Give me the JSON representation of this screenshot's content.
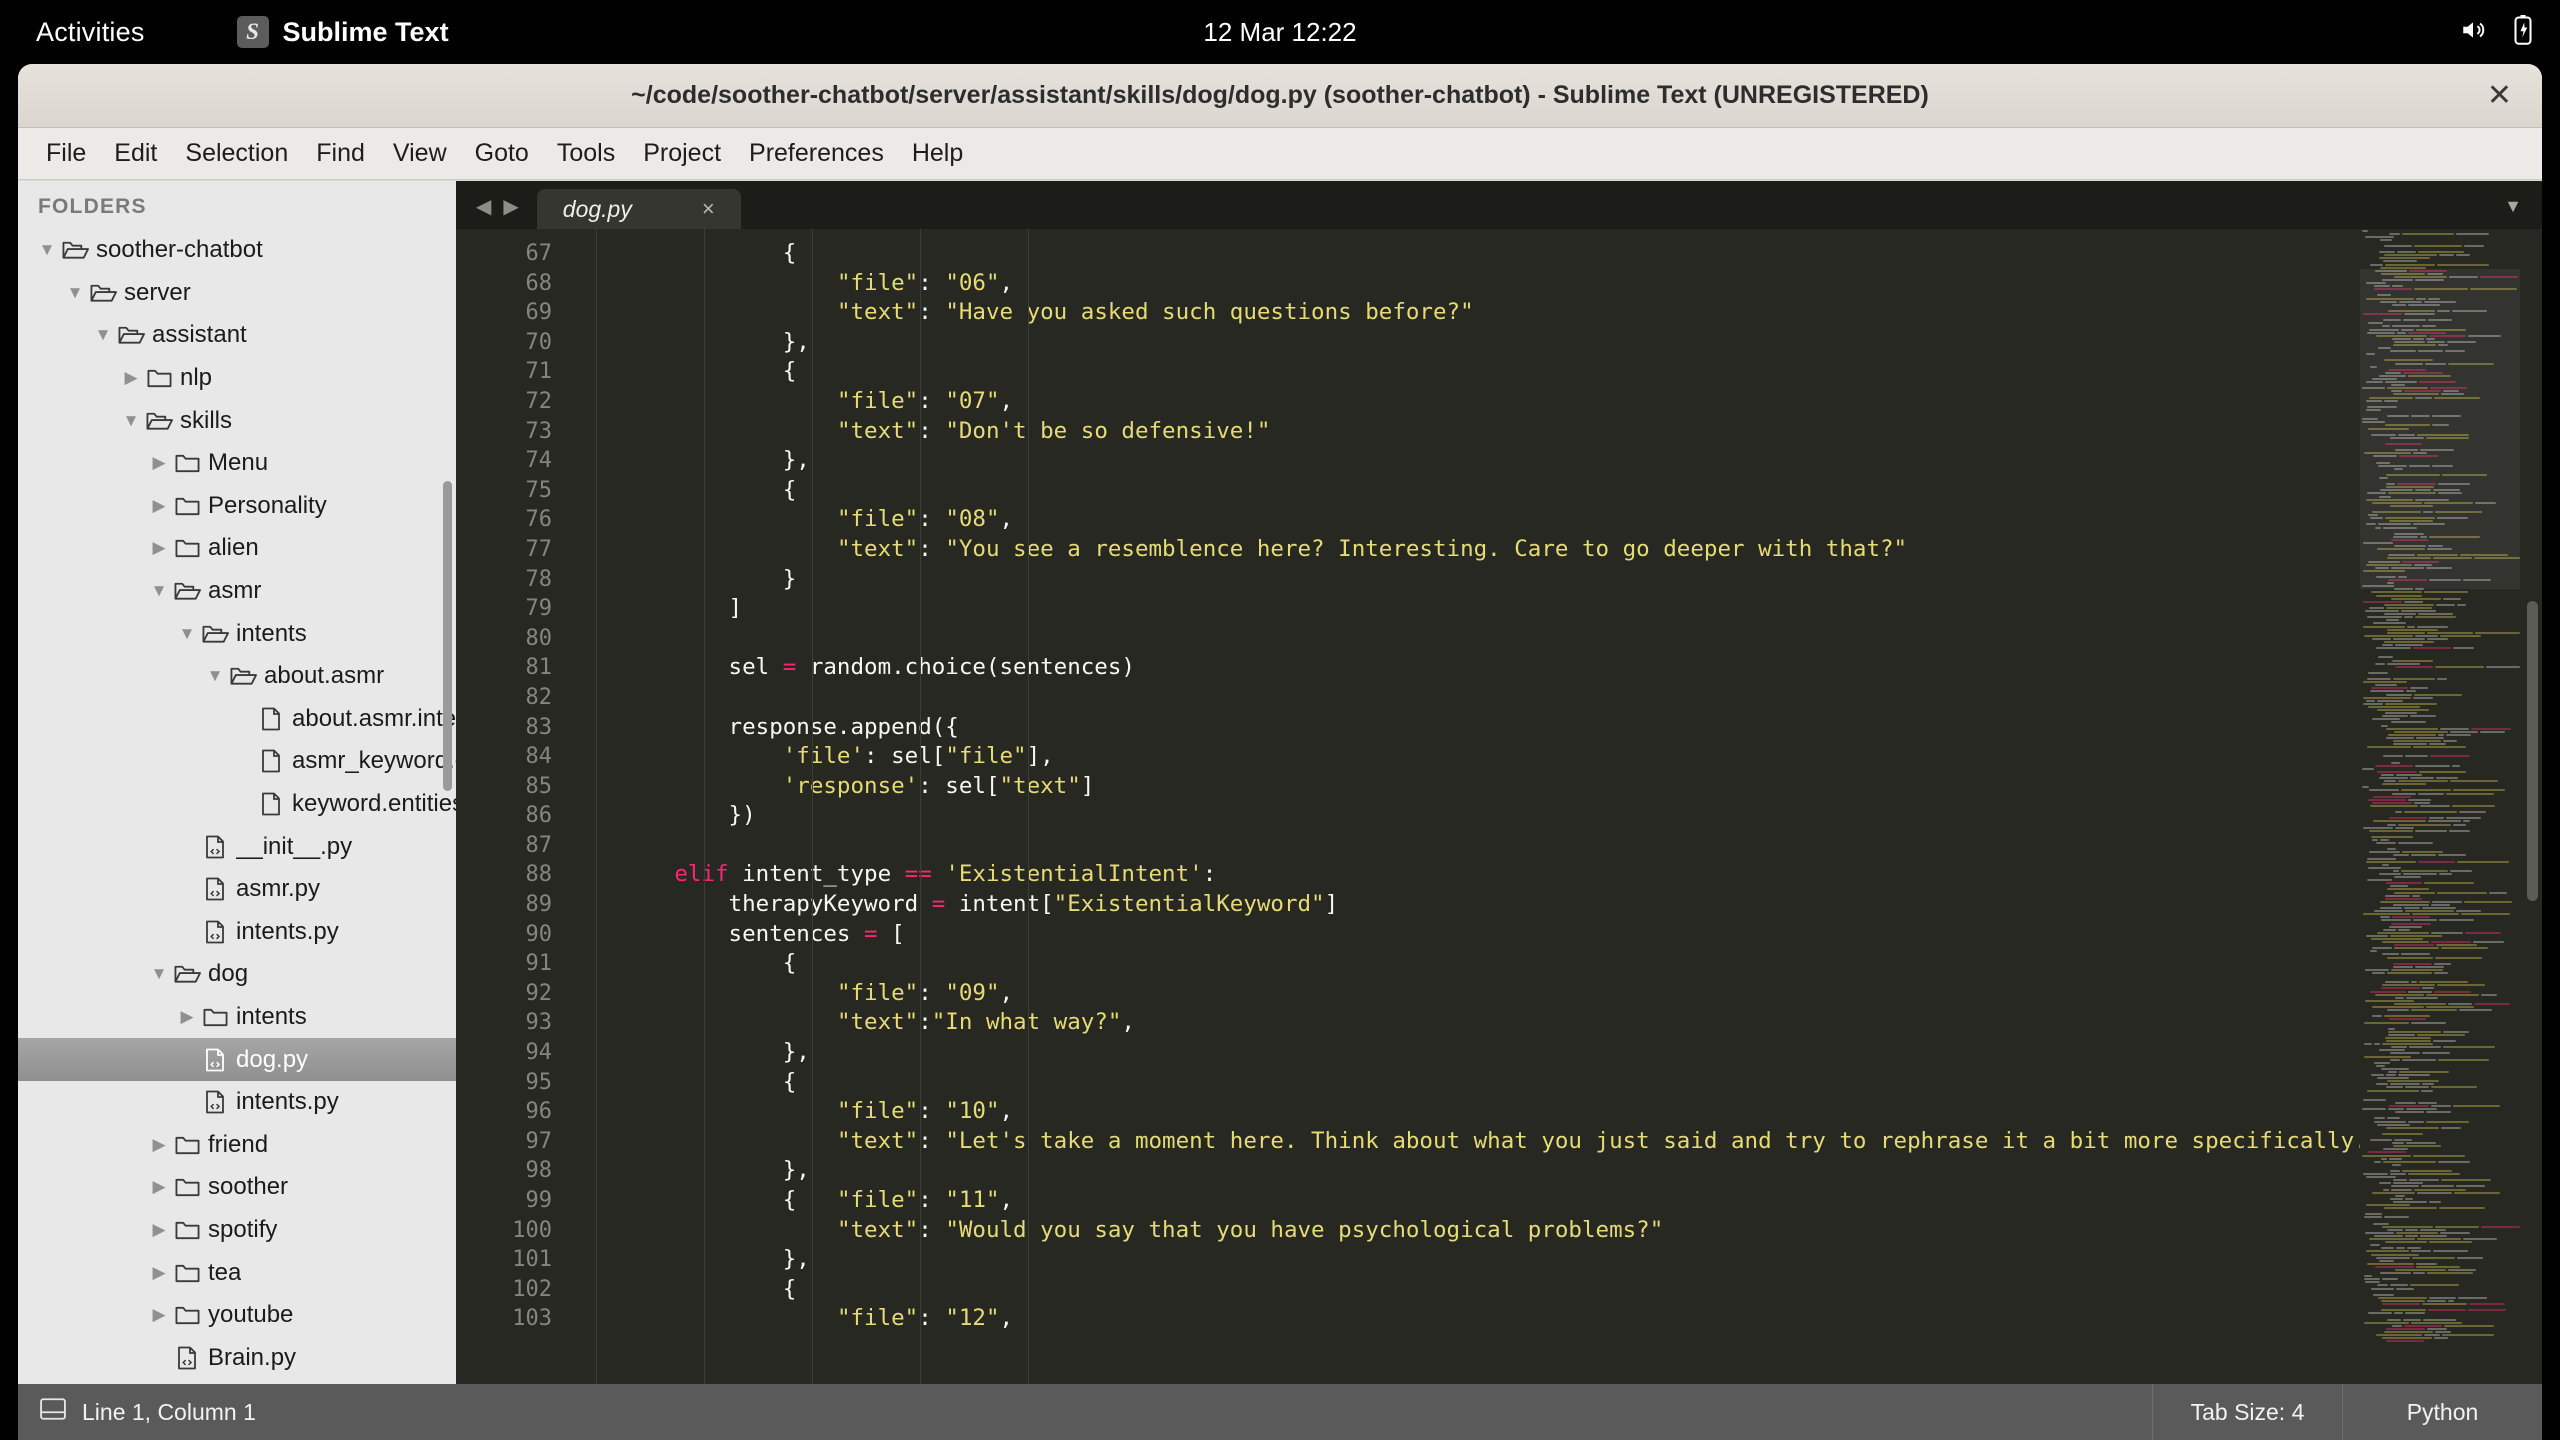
{
  "gnome": {
    "activities": "Activities",
    "app_name": "Sublime Text",
    "app_logo_glyph": "S",
    "clock": "12 Mar  12:22",
    "tray": [
      "volume-icon",
      "battery-icon"
    ]
  },
  "window": {
    "title": "~/code/soother-chatbot/server/assistant/skills/dog/dog.py (soother-chatbot) - Sublime Text (UNREGISTERED)",
    "close_glyph": "✕"
  },
  "menubar": [
    "File",
    "Edit",
    "Selection",
    "Find",
    "View",
    "Goto",
    "Tools",
    "Project",
    "Preferences",
    "Help"
  ],
  "sidebar": {
    "header": "FOLDERS",
    "tree": [
      {
        "label": "soother-chatbot",
        "depth": 0,
        "type": "folder",
        "state": "open"
      },
      {
        "label": "server",
        "depth": 1,
        "type": "folder",
        "state": "open"
      },
      {
        "label": "assistant",
        "depth": 2,
        "type": "folder",
        "state": "open"
      },
      {
        "label": "nlp",
        "depth": 3,
        "type": "folder",
        "state": "closed"
      },
      {
        "label": "skills",
        "depth": 3,
        "type": "folder",
        "state": "open"
      },
      {
        "label": "Menu",
        "depth": 4,
        "type": "folder",
        "state": "closed"
      },
      {
        "label": "Personality",
        "depth": 4,
        "type": "folder",
        "state": "closed"
      },
      {
        "label": "alien",
        "depth": 4,
        "type": "folder",
        "state": "closed"
      },
      {
        "label": "asmr",
        "depth": 4,
        "type": "folder",
        "state": "open"
      },
      {
        "label": "intents",
        "depth": 5,
        "type": "folder",
        "state": "open"
      },
      {
        "label": "about.asmr",
        "depth": 6,
        "type": "folder",
        "state": "open"
      },
      {
        "label": "about.asmr.intent",
        "depth": 7,
        "type": "file",
        "state": "none"
      },
      {
        "label": "asmr_keyword.entity",
        "depth": 7,
        "type": "file",
        "state": "none"
      },
      {
        "label": "keyword.entities",
        "depth": 7,
        "type": "file",
        "state": "none"
      },
      {
        "label": "__init__.py",
        "depth": 5,
        "type": "pyfile",
        "state": "none"
      },
      {
        "label": "asmr.py",
        "depth": 5,
        "type": "pyfile",
        "state": "none"
      },
      {
        "label": "intents.py",
        "depth": 5,
        "type": "pyfile",
        "state": "none"
      },
      {
        "label": "dog",
        "depth": 4,
        "type": "folder",
        "state": "open"
      },
      {
        "label": "intents",
        "depth": 5,
        "type": "folder",
        "state": "closed"
      },
      {
        "label": "dog.py",
        "depth": 5,
        "type": "pyfile",
        "state": "none",
        "selected": true
      },
      {
        "label": "intents.py",
        "depth": 5,
        "type": "pyfile",
        "state": "none"
      },
      {
        "label": "friend",
        "depth": 4,
        "type": "folder",
        "state": "closed"
      },
      {
        "label": "soother",
        "depth": 4,
        "type": "folder",
        "state": "closed"
      },
      {
        "label": "spotify",
        "depth": 4,
        "type": "folder",
        "state": "closed"
      },
      {
        "label": "tea",
        "depth": 4,
        "type": "folder",
        "state": "closed"
      },
      {
        "label": "youtube",
        "depth": 4,
        "type": "folder",
        "state": "closed"
      },
      {
        "label": "Brain.py",
        "depth": 4,
        "type": "pyfile",
        "state": "none"
      }
    ]
  },
  "editor": {
    "tab_nav_prev": "◀",
    "tab_nav_next": "▶",
    "tab_name": "dog.py",
    "tab_close_glyph": "×",
    "tab_menu_glyph": "▼",
    "first_line_number": 67,
    "lines": [
      {
        "n": 67,
        "tokens": [
          {
            "t": "                {",
            "c": "pl"
          }
        ]
      },
      {
        "n": 68,
        "tokens": [
          {
            "t": "                    ",
            "c": "pl"
          },
          {
            "t": "\"file\"",
            "c": "str"
          },
          {
            "t": ": ",
            "c": "pl"
          },
          {
            "t": "\"06\"",
            "c": "str"
          },
          {
            "t": ",",
            "c": "pl"
          }
        ]
      },
      {
        "n": 69,
        "tokens": [
          {
            "t": "                    ",
            "c": "pl"
          },
          {
            "t": "\"text\"",
            "c": "str"
          },
          {
            "t": ": ",
            "c": "pl"
          },
          {
            "t": "\"Have you asked such questions before?\"",
            "c": "str"
          }
        ]
      },
      {
        "n": 70,
        "tokens": [
          {
            "t": "                },",
            "c": "pl"
          }
        ]
      },
      {
        "n": 71,
        "tokens": [
          {
            "t": "                {",
            "c": "pl"
          }
        ]
      },
      {
        "n": 72,
        "tokens": [
          {
            "t": "                    ",
            "c": "pl"
          },
          {
            "t": "\"file\"",
            "c": "str"
          },
          {
            "t": ": ",
            "c": "pl"
          },
          {
            "t": "\"07\"",
            "c": "str"
          },
          {
            "t": ",",
            "c": "pl"
          }
        ]
      },
      {
        "n": 73,
        "tokens": [
          {
            "t": "                    ",
            "c": "pl"
          },
          {
            "t": "\"text\"",
            "c": "str"
          },
          {
            "t": ": ",
            "c": "pl"
          },
          {
            "t": "\"Don't be so defensive!\"",
            "c": "str"
          }
        ]
      },
      {
        "n": 74,
        "tokens": [
          {
            "t": "                },",
            "c": "pl"
          }
        ]
      },
      {
        "n": 75,
        "tokens": [
          {
            "t": "                {",
            "c": "pl"
          }
        ]
      },
      {
        "n": 76,
        "tokens": [
          {
            "t": "                    ",
            "c": "pl"
          },
          {
            "t": "\"file\"",
            "c": "str"
          },
          {
            "t": ": ",
            "c": "pl"
          },
          {
            "t": "\"08\"",
            "c": "str"
          },
          {
            "t": ",",
            "c": "pl"
          }
        ]
      },
      {
        "n": 77,
        "tokens": [
          {
            "t": "                    ",
            "c": "pl"
          },
          {
            "t": "\"text\"",
            "c": "str"
          },
          {
            "t": ": ",
            "c": "pl"
          },
          {
            "t": "\"You see a resemblence here? Interesting. Care to go deeper with that?\"",
            "c": "str"
          }
        ]
      },
      {
        "n": 78,
        "tokens": [
          {
            "t": "                }",
            "c": "pl"
          }
        ]
      },
      {
        "n": 79,
        "tokens": [
          {
            "t": "            ]",
            "c": "pl"
          }
        ]
      },
      {
        "n": 80,
        "tokens": [
          {
            "t": "",
            "c": "pl"
          }
        ]
      },
      {
        "n": 81,
        "tokens": [
          {
            "t": "            sel ",
            "c": "pl"
          },
          {
            "t": "=",
            "c": "op"
          },
          {
            "t": " random.choice(sentences)",
            "c": "pl"
          }
        ]
      },
      {
        "n": 82,
        "tokens": [
          {
            "t": "",
            "c": "pl"
          }
        ]
      },
      {
        "n": 83,
        "tokens": [
          {
            "t": "            response.append({",
            "c": "pl"
          }
        ]
      },
      {
        "n": 84,
        "tokens": [
          {
            "t": "                ",
            "c": "pl"
          },
          {
            "t": "'file'",
            "c": "str"
          },
          {
            "t": ": sel[",
            "c": "pl"
          },
          {
            "t": "\"file\"",
            "c": "str"
          },
          {
            "t": "],",
            "c": "pl"
          }
        ]
      },
      {
        "n": 85,
        "tokens": [
          {
            "t": "                ",
            "c": "pl"
          },
          {
            "t": "'response'",
            "c": "str"
          },
          {
            "t": ": sel[",
            "c": "pl"
          },
          {
            "t": "\"text\"",
            "c": "str"
          },
          {
            "t": "]",
            "c": "pl"
          }
        ]
      },
      {
        "n": 86,
        "tokens": [
          {
            "t": "            })",
            "c": "pl"
          }
        ]
      },
      {
        "n": 87,
        "tokens": [
          {
            "t": "",
            "c": "pl"
          }
        ]
      },
      {
        "n": 88,
        "tokens": [
          {
            "t": "        ",
            "c": "pl"
          },
          {
            "t": "elif",
            "c": "kw"
          },
          {
            "t": " intent_type ",
            "c": "pl"
          },
          {
            "t": "==",
            "c": "op"
          },
          {
            "t": " ",
            "c": "pl"
          },
          {
            "t": "'ExistentialIntent'",
            "c": "str"
          },
          {
            "t": ":",
            "c": "pl"
          }
        ]
      },
      {
        "n": 89,
        "tokens": [
          {
            "t": "            therapyKeyword ",
            "c": "pl"
          },
          {
            "t": "=",
            "c": "op"
          },
          {
            "t": " intent[",
            "c": "pl"
          },
          {
            "t": "\"ExistentialKeyword\"",
            "c": "str"
          },
          {
            "t": "]",
            "c": "pl"
          }
        ]
      },
      {
        "n": 90,
        "tokens": [
          {
            "t": "            sentences ",
            "c": "pl"
          },
          {
            "t": "=",
            "c": "op"
          },
          {
            "t": " [",
            "c": "pl"
          }
        ]
      },
      {
        "n": 91,
        "tokens": [
          {
            "t": "                {",
            "c": "pl"
          }
        ]
      },
      {
        "n": 92,
        "tokens": [
          {
            "t": "                    ",
            "c": "pl"
          },
          {
            "t": "\"file\"",
            "c": "str"
          },
          {
            "t": ": ",
            "c": "pl"
          },
          {
            "t": "\"09\"",
            "c": "str"
          },
          {
            "t": ",",
            "c": "pl"
          }
        ]
      },
      {
        "n": 93,
        "tokens": [
          {
            "t": "                    ",
            "c": "pl"
          },
          {
            "t": "\"text\"",
            "c": "str"
          },
          {
            "t": ":",
            "c": "pl"
          },
          {
            "t": "\"In what way?\"",
            "c": "str"
          },
          {
            "t": ",",
            "c": "pl"
          }
        ]
      },
      {
        "n": 94,
        "tokens": [
          {
            "t": "                },",
            "c": "pl"
          }
        ]
      },
      {
        "n": 95,
        "tokens": [
          {
            "t": "                {",
            "c": "pl"
          }
        ]
      },
      {
        "n": 96,
        "tokens": [
          {
            "t": "                    ",
            "c": "pl"
          },
          {
            "t": "\"file\"",
            "c": "str"
          },
          {
            "t": ": ",
            "c": "pl"
          },
          {
            "t": "\"10\"",
            "c": "str"
          },
          {
            "t": ",",
            "c": "pl"
          }
        ]
      },
      {
        "n": 97,
        "tokens": [
          {
            "t": "                    ",
            "c": "pl"
          },
          {
            "t": "\"text\"",
            "c": "str"
          },
          {
            "t": ": ",
            "c": "pl"
          },
          {
            "t": "\"Let's take a moment here. Think about what you just said and try to rephrase it a bit more specifically.\"",
            "c": "str"
          }
        ]
      },
      {
        "n": 98,
        "tokens": [
          {
            "t": "                },",
            "c": "pl"
          }
        ]
      },
      {
        "n": 99,
        "tokens": [
          {
            "t": "                {   ",
            "c": "pl"
          },
          {
            "t": "\"file\"",
            "c": "str"
          },
          {
            "t": ": ",
            "c": "pl"
          },
          {
            "t": "\"11\"",
            "c": "str"
          },
          {
            "t": ",",
            "c": "pl"
          }
        ]
      },
      {
        "n": 100,
        "tokens": [
          {
            "t": "                    ",
            "c": "pl"
          },
          {
            "t": "\"text\"",
            "c": "str"
          },
          {
            "t": ": ",
            "c": "pl"
          },
          {
            "t": "\"Would you say that you have psychological problems?\"",
            "c": "str"
          }
        ]
      },
      {
        "n": 101,
        "tokens": [
          {
            "t": "                },",
            "c": "pl"
          }
        ]
      },
      {
        "n": 102,
        "tokens": [
          {
            "t": "                {",
            "c": "pl"
          }
        ]
      },
      {
        "n": 103,
        "tokens": [
          {
            "t": "                    ",
            "c": "pl"
          },
          {
            "t": "\"file\"",
            "c": "str"
          },
          {
            "t": ": ",
            "c": "pl"
          },
          {
            "t": "\"12\"",
            "c": "str"
          },
          {
            "t": ",",
            "c": "pl"
          }
        ]
      }
    ]
  },
  "statusbar": {
    "position": "Line 1, Column 1",
    "tab_size": "Tab Size: 4",
    "syntax": "Python"
  },
  "colors": {
    "editor_bg": "#272822",
    "string": "#e6db74",
    "keyword": "#f92672",
    "plain": "#f8f8f2",
    "gutter": "#85867f",
    "selection": "#9a9a9a"
  }
}
